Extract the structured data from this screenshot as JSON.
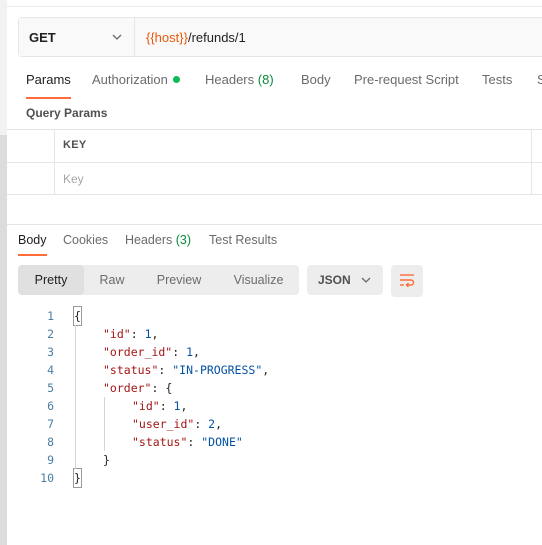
{
  "request": {
    "method": "GET",
    "url_var": "{{host}}",
    "url_path": "/refunds/1"
  },
  "request_tabs": [
    {
      "label": "Params",
      "active": true
    },
    {
      "label": "Authorization",
      "dot": true
    },
    {
      "label": "Headers",
      "count": "(8)"
    },
    {
      "label": "Body"
    },
    {
      "label": "Pre-request Script"
    },
    {
      "label": "Tests"
    },
    {
      "label": "S"
    }
  ],
  "query_params": {
    "title": "Query Params",
    "key_header": "KEY",
    "key_placeholder": "Key"
  },
  "response_tabs": [
    {
      "label": "Body",
      "active": true
    },
    {
      "label": "Cookies"
    },
    {
      "label": "Headers",
      "count": "(3)"
    },
    {
      "label": "Test Results"
    }
  ],
  "view_modes": [
    "Pretty",
    "Raw",
    "Preview",
    "Visualize"
  ],
  "active_view": "Pretty",
  "format": "JSON",
  "code_lines": [
    {
      "n": "1",
      "indent": 0,
      "parts": [
        [
          "p",
          "{"
        ]
      ]
    },
    {
      "n": "2",
      "indent": 1,
      "parts": [
        [
          "k",
          "\"id\""
        ],
        [
          "p",
          ": "
        ],
        [
          "n",
          "1"
        ],
        [
          "p",
          ","
        ]
      ]
    },
    {
      "n": "3",
      "indent": 1,
      "parts": [
        [
          "k",
          "\"order_id\""
        ],
        [
          "p",
          ": "
        ],
        [
          "n",
          "1"
        ],
        [
          "p",
          ","
        ]
      ]
    },
    {
      "n": "4",
      "indent": 1,
      "parts": [
        [
          "k",
          "\"status\""
        ],
        [
          "p",
          ": "
        ],
        [
          "s",
          "\"IN-PROGRESS\""
        ],
        [
          "p",
          ","
        ]
      ]
    },
    {
      "n": "5",
      "indent": 1,
      "parts": [
        [
          "k",
          "\"order\""
        ],
        [
          "p",
          ": {"
        ]
      ]
    },
    {
      "n": "6",
      "indent": 2,
      "parts": [
        [
          "k",
          "\"id\""
        ],
        [
          "p",
          ": "
        ],
        [
          "n",
          "1"
        ],
        [
          "p",
          ","
        ]
      ]
    },
    {
      "n": "7",
      "indent": 2,
      "parts": [
        [
          "k",
          "\"user_id\""
        ],
        [
          "p",
          ": "
        ],
        [
          "n",
          "2"
        ],
        [
          "p",
          ","
        ]
      ]
    },
    {
      "n": "8",
      "indent": 2,
      "parts": [
        [
          "k",
          "\"status\""
        ],
        [
          "p",
          ": "
        ],
        [
          "s",
          "\"DONE\""
        ]
      ]
    },
    {
      "n": "9",
      "indent": 1,
      "parts": [
        [
          "p",
          "}"
        ]
      ]
    },
    {
      "n": "10",
      "indent": 0,
      "parts": [
        [
          "p",
          "}"
        ]
      ]
    }
  ],
  "colors": {
    "accent": "#ff6c37",
    "url_variable": "#e8590c",
    "auth_dot": "#0cbb52",
    "count": "#0a8a3c",
    "json_key": "#a31515",
    "json_value": "#0451a5"
  }
}
